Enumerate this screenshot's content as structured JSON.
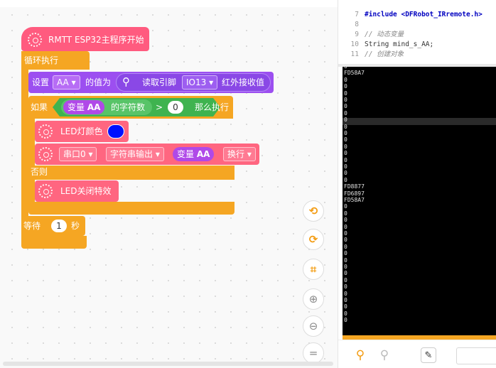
{
  "workspace": {
    "hat": {
      "label": "RMTT ESP32主程序开始"
    },
    "loop": {
      "label": "循环执行"
    },
    "set_block": {
      "prefix": "设置",
      "var": "AA",
      "value_label": "的值为",
      "read_pin": "读取引脚",
      "pin": "IO13",
      "ir_label": "红外接收值"
    },
    "if_block": {
      "if_label": "如果",
      "var_prefix": "变量",
      "var": "AA",
      "length_label": "的字符数",
      "op": ">",
      "num": "0",
      "then_label": "那么执行",
      "else_label": "否则"
    },
    "led_color": {
      "label": "LED灯颜色",
      "color": "#0010ff"
    },
    "serial_print": {
      "port": "串口0",
      "mode": "字符串输出",
      "var_prefix": "变量",
      "var": "AA",
      "newline": "换行"
    },
    "led_off": {
      "label": "LED关闭特效"
    },
    "wait": {
      "label": "等待",
      "num": "1",
      "unit": "秒"
    },
    "colors": {
      "control": "#f5a623",
      "hat": "#ff5b7f",
      "action": "#ff6680",
      "green": "#3fb34f",
      "purple": "#9c4ff0",
      "ir": "#8a48e6",
      "var": "#b049e8"
    }
  },
  "toolbar": {
    "undo_icon": "undo-icon",
    "redo_icon": "redo-icon",
    "crop_icon": "crop-icon",
    "zoom_in_icon": "zoom-in-icon",
    "zoom_out_icon": "zoom-out-icon",
    "reset_icon": "reset-icon"
  },
  "code": {
    "lines": [
      {
        "n": "7",
        "text": "#include <DFRobot_IRremote.h>"
      },
      {
        "n": "8",
        "text": ""
      },
      {
        "n": "9",
        "text": "// 动态变量"
      },
      {
        "n": "10",
        "text": "String mind_s_AA;"
      },
      {
        "n": "11",
        "text": "// 创建对象"
      }
    ]
  },
  "serial": {
    "lines": [
      "0",
      "FD58A7",
      "0",
      "0",
      "0",
      "0",
      "0",
      "0",
      "0",
      "0",
      "0",
      "0",
      "0",
      "0",
      "0",
      "0",
      "0",
      "0",
      "FD8877",
      "FD6897",
      "FD58A7",
      "0",
      "0",
      "0",
      "0",
      "0",
      "0",
      "0",
      "0",
      "0",
      "0",
      "0",
      "0",
      "0",
      "0",
      "0",
      "0",
      "0",
      "0"
    ]
  },
  "bottom": {
    "usb_icon": "usb-icon",
    "usb_off_icon": "usb-disconnect-icon",
    "clear_icon": "clear-icon"
  }
}
